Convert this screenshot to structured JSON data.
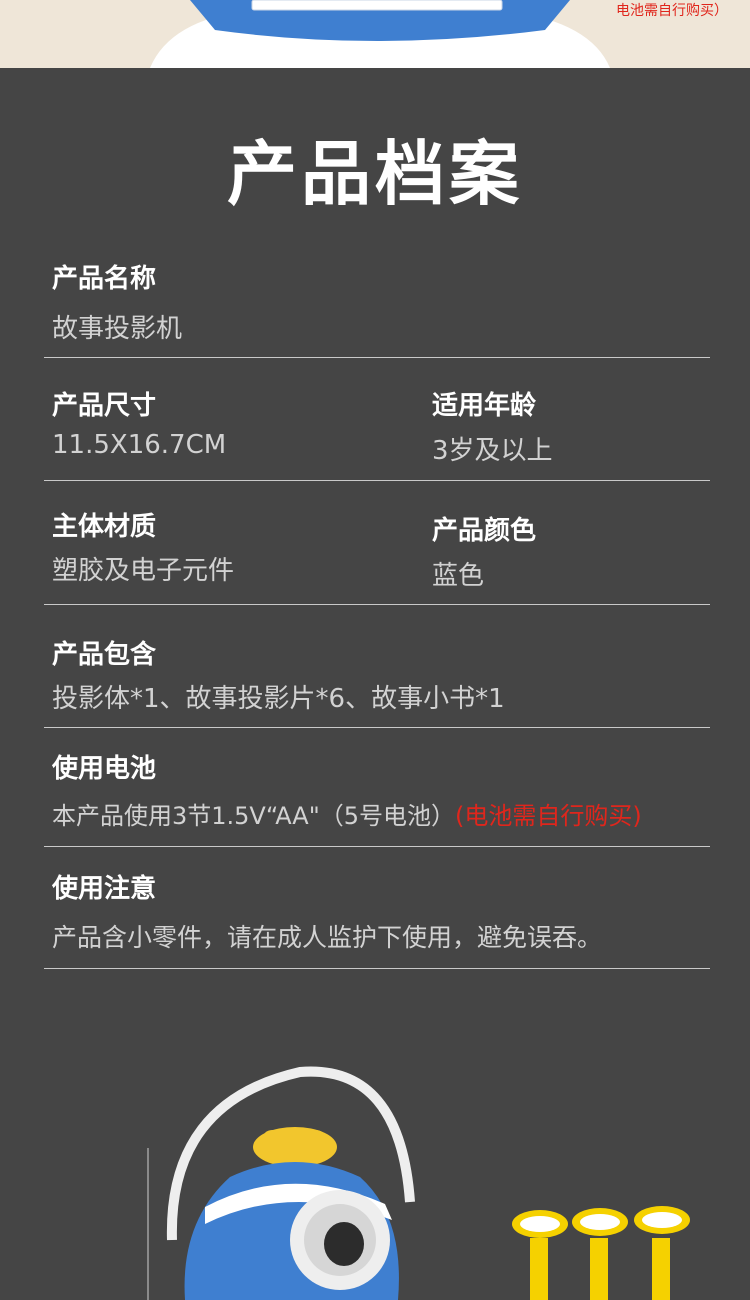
{
  "top_banner": {
    "note": "电池需自行购买）"
  },
  "title": "产品档案",
  "specs": {
    "name": {
      "label": "产品名称",
      "value": "故事投影机"
    },
    "size": {
      "label": "产品尺寸",
      "value": "11.5X16.7CM"
    },
    "age": {
      "label": "适用年龄",
      "value": "3岁及以上"
    },
    "material": {
      "label": "主体材质",
      "value": "塑胶及电子元件"
    },
    "color": {
      "label": "产品颜色",
      "value": "蓝色"
    },
    "contents": {
      "label": "产品包含",
      "value": "投影体*1、故事投影片*6、故事小书*1"
    },
    "battery": {
      "label": "使用电池",
      "value": "本产品使用3节1.5V“AA\"（5号电池）",
      "note": "(电池需自行购买)"
    },
    "caution": {
      "label": "使用注意",
      "value": "产品含小零件，请在成人监护下使用，避免误吞。"
    }
  },
  "colors": {
    "background": "#454545",
    "divider": "#c9c9c9",
    "value_text": "#d2d2d2",
    "warning": "#e0261c",
    "product_blue": "#3f7fd0"
  },
  "illustration": {
    "icon": "story-projector-product-icon"
  }
}
